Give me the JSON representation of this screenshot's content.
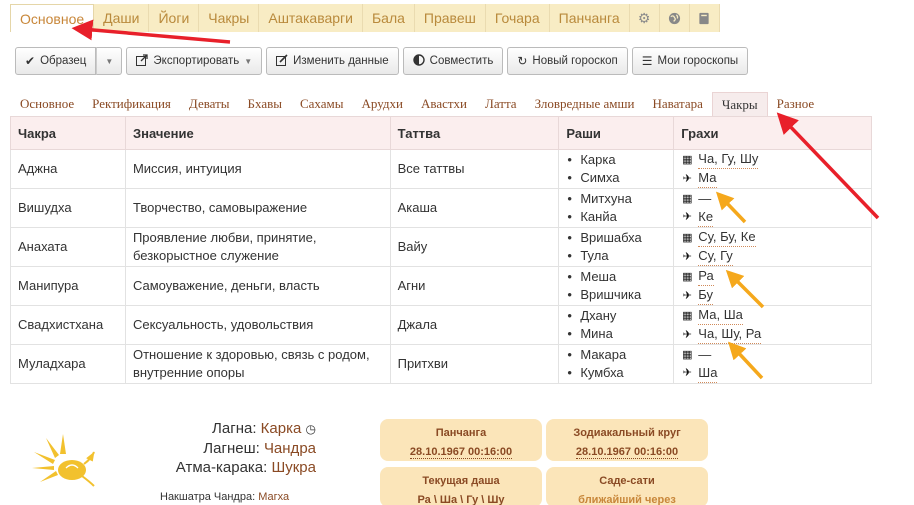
{
  "top_tabs": [
    "Основное",
    "Даши",
    "Йоги",
    "Чакры",
    "Аштакаварги",
    "Бала",
    "Правеш",
    "Гочара",
    "Панчанга"
  ],
  "top_icons": [
    "gear-icon",
    "globe-icon",
    "book-icon"
  ],
  "toolbar": {
    "sample": "Образец",
    "export": "Экспортировать",
    "edit": "Изменить данные",
    "combine": "Совместить",
    "new": "Новый гороскоп",
    "mine": "Мои гороскопы"
  },
  "sub_tabs": [
    "Основное",
    "Ректификация",
    "Деваты",
    "Бхавы",
    "Сахамы",
    "Арудхи",
    "Авастхи",
    "Латта",
    "Зловредные амши",
    "Наватара",
    "Чакры",
    "Разное"
  ],
  "table": {
    "headers": [
      "Чакра",
      "Значение",
      "Таттва",
      "Раши",
      "Грахи"
    ],
    "rows": [
      {
        "chakra": "Аджна",
        "meaning": "Миссия, интуиция",
        "tattva": "Все таттвы",
        "rashi1": "Карка",
        "rashi2": "Симха",
        "g1": "Ча, Гу, Шу",
        "g2": "Ма"
      },
      {
        "chakra": "Вишудха",
        "meaning": "Творчество, самовыражение",
        "tattva": "Акаша",
        "rashi1": "Митхуна",
        "rashi2": "Канйа",
        "g1": "—",
        "g2": "Ке"
      },
      {
        "chakra": "Анахата",
        "meaning": "Проявление любви, принятие, безкорыстное служение",
        "tattva": "Вайу",
        "rashi1": "Вришабха",
        "rashi2": "Тула",
        "g1": "Су, Бу, Ке",
        "g2": "Су, Гу"
      },
      {
        "chakra": "Манипура",
        "meaning": "Самоуважение, деньги, власть",
        "tattva": "Агни",
        "rashi1": "Меша",
        "rashi2": "Вришчика",
        "g1": "Ра",
        "g2": "Бу"
      },
      {
        "chakra": "Свадхистхана",
        "meaning": "Сексуальность, удовольствия",
        "tattva": "Джала",
        "rashi1": "Дхану",
        "rashi2": "Мина",
        "g1": "Ма, Ша",
        "g2": "Ча, Шу, Ра"
      },
      {
        "chakra": "Муладхара",
        "meaning": "Отношение к здоровью, связь с родом, внутренние опоры",
        "tattva": "Притхви",
        "rashi1": "Макара",
        "rashi2": "Кумбха",
        "g1": "—",
        "g2": "Ша"
      }
    ]
  },
  "info": {
    "lagna_label": "Лагна:",
    "lagna": "Карка",
    "lagnesh_label": "Лагнеш:",
    "lagnesh": "Чандра",
    "atma_label": "Атма-карака:",
    "atma": "Шукра",
    "nak_label": "Накшатра Чандра:",
    "nak": "Магха"
  },
  "cards": {
    "panchanga": {
      "title": "Панчанга",
      "value": "28.10.1967 00:16:00"
    },
    "zodiac": {
      "title": "Зодиакальный круг",
      "value": "28.10.1967 00:16:00"
    },
    "dasha": {
      "title": "Текущая даша",
      "value": "Ра \\ Ша \\ Гу \\ Шу"
    },
    "sade": {
      "title": "Саде-сати",
      "value": "ближайший через"
    }
  },
  "colors": {
    "accent": "#8a4a24",
    "tab_bg": "#f8ecc4",
    "card_bg": "#fbe5b9",
    "arrow_red": "#e8202a",
    "arrow_orange": "#f5a81c"
  }
}
